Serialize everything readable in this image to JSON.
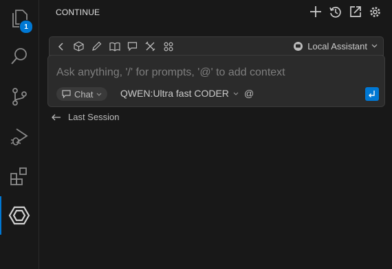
{
  "activity_bar": {
    "explorer_badge": "1"
  },
  "panel": {
    "title": "CONTINUE"
  },
  "toolbar": {
    "assistant_label": "Local Assistant"
  },
  "input": {
    "placeholder": "Ask anything, '/' for prompts, '@' to add context",
    "mode_label": "Chat",
    "model_label": "QWEN:Ultra fast CODER",
    "at_label": "@"
  },
  "history": {
    "last_session_label": "Last Session"
  },
  "colors": {
    "accent": "#0078d4",
    "background": "#181818",
    "input_bg": "#2b2b2b"
  }
}
